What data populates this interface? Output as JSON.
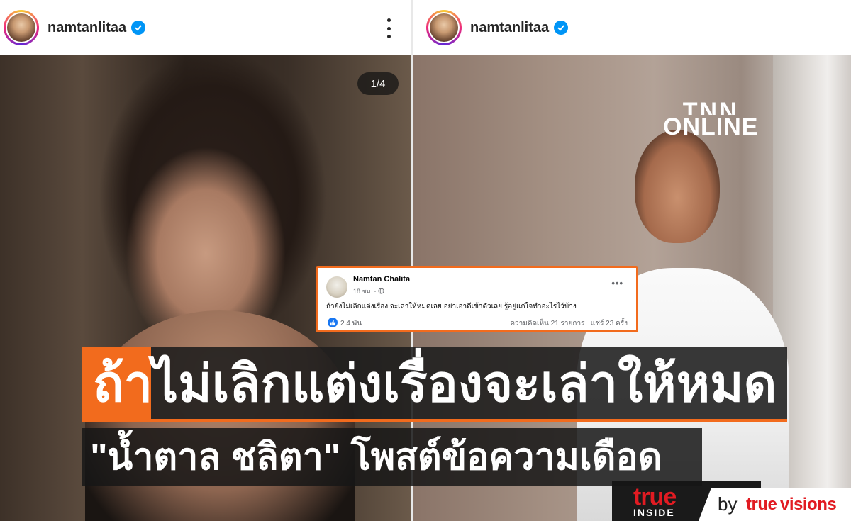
{
  "left_post": {
    "username": "namtanlitaa",
    "counter": "1/4"
  },
  "right_post": {
    "username": "namtanlitaa",
    "watermark": {
      "top": "TNN",
      "bottom": "ONLINE"
    }
  },
  "fb_post": {
    "name": "Namtan Chalita",
    "time": "18 ชม. ·",
    "text": "ถ้ายังไม่เลิกแต่งเรื่อง จะเล่าให้หมดเลย อย่าเอาดีเข้าตัวเลย รู้อยู่แก่ใจทำอะไรไว้บ้าง",
    "likes": "2.4 พัน",
    "stats": "ความคิดเห็น 21 รายการ   แชร์ 23 ครั้ง",
    "more": "•••"
  },
  "headline": {
    "line1": "ถ้าไม่เลิกแต่งเรื่องจะเล่าให้หมด",
    "line2": "\"น้ำตาล ชลิตา\" โพสต์ข้อความเดือด"
  },
  "branding": {
    "true_inside_top": "true",
    "true_inside_bottom": "INSIDE",
    "by": "by",
    "truevisions_a": "true",
    "truevisions_b": "visions"
  },
  "colors": {
    "accent_orange": "#f26b1d",
    "instagram_verified": "#0095f6",
    "facebook_blue": "#1877f2",
    "true_red": "#e11b22"
  },
  "icons": [
    "verified-badge-icon",
    "more-options-icon",
    "globe-icon",
    "like-icon"
  ]
}
